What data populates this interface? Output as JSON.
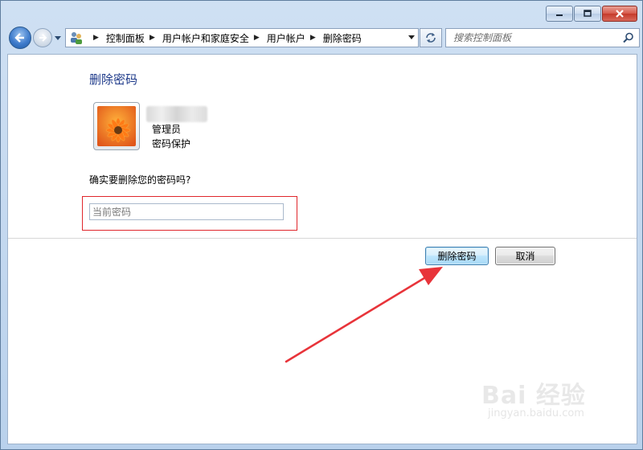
{
  "titlebar": {
    "controls": [
      "minimize",
      "maximize",
      "close"
    ]
  },
  "nav": {
    "back_icon": "back-arrow-icon",
    "forward_icon": "forward-arrow-icon",
    "breadcrumbs": [
      "控制面板",
      "用户帐户和家庭安全",
      "用户帐户",
      "删除密码"
    ],
    "search_placeholder": "搜索控制面板"
  },
  "page": {
    "title": "删除密码",
    "user": {
      "role": "管理员",
      "status": "密码保护"
    },
    "question": "确实要删除您的密码吗?",
    "password_placeholder": "当前密码",
    "buttons": {
      "delete": "删除密码",
      "cancel": "取消"
    }
  },
  "watermark": {
    "main": "Bai 经验",
    "sub": "jingyan.baidu.com"
  },
  "colors": {
    "title": "#1e3a8a",
    "highlight_border": "#e0262b",
    "annotation_arrow": "#e8343a"
  }
}
